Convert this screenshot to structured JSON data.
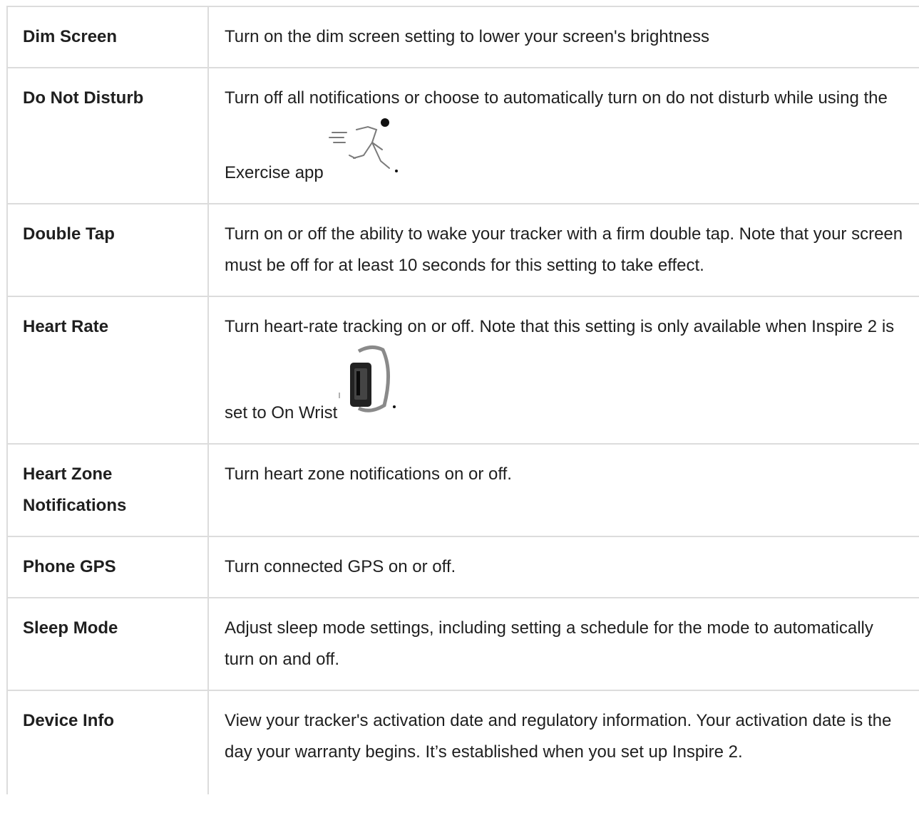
{
  "rows": [
    {
      "name": "Dim Screen",
      "desc": "Turn on the dim screen setting to lower your screen's brightness"
    },
    {
      "name": "Do Not Disturb",
      "desc": "Turn off all notifications or choose to automatically turn on do not disturb while using the Exercise app",
      "icon": "exercise-runner-icon"
    },
    {
      "name": "Double Tap",
      "desc": "Turn on or off the ability to wake your tracker with a firm double tap. Note that your screen must be off for at least 10 seconds for this setting to take effect."
    },
    {
      "name": "Heart Rate",
      "desc": "Turn heart-rate tracking on or off. Note that this setting is only available when Inspire 2 is set to On Wrist",
      "icon": "on-wrist-tracker-icon"
    },
    {
      "name": "Heart Zone Notifications",
      "desc": "Turn heart zone notifications on or off."
    },
    {
      "name": "Phone GPS",
      "desc": "Turn connected GPS on or off."
    },
    {
      "name": "Sleep Mode",
      "desc": "Adjust sleep mode settings, including setting a schedule for the mode to automatically turn on and off."
    },
    {
      "name": "Device Info",
      "desc": "View your tracker's activation date and regulatory information. Your activation date is the day your warranty begins. It’s established when you set up Inspire 2."
    }
  ],
  "icons": {
    "exercise": "exercise-runner-icon",
    "wrist": "on-wrist-tracker-icon"
  }
}
